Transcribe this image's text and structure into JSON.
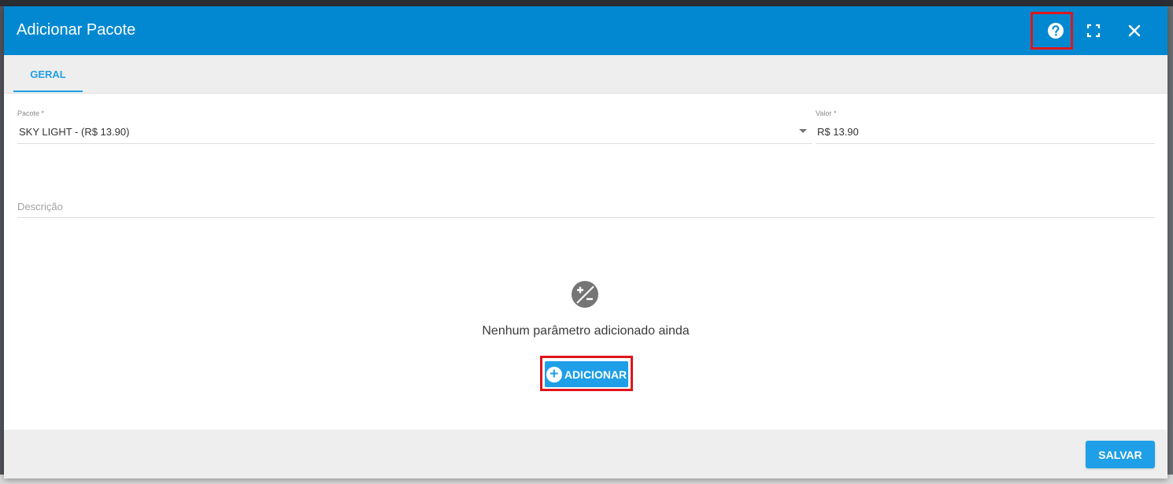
{
  "dialog": {
    "title": "Adicionar Pacote",
    "header_color": "#0288d1",
    "accent_color": "#1e9fe8",
    "highlight_color": "#e0151b",
    "icons": [
      "help-icon",
      "fullscreen-icon",
      "close-icon"
    ]
  },
  "tabs": [
    {
      "label": "GERAL",
      "active": true
    }
  ],
  "form": {
    "pacote": {
      "label": "Pacote *",
      "value": "SKY LIGHT - (R$ 13.90)"
    },
    "valor": {
      "label": "Valor *",
      "value": "R$ 13.90"
    },
    "descricao": {
      "placeholder": "Descrição",
      "value": ""
    }
  },
  "empty_state": {
    "icon": "plus-minus-icon",
    "message": "Nenhum parâmetro adicionado ainda",
    "add_label": "ADICIONAR"
  },
  "footer": {
    "save_label": "SALVAR"
  }
}
